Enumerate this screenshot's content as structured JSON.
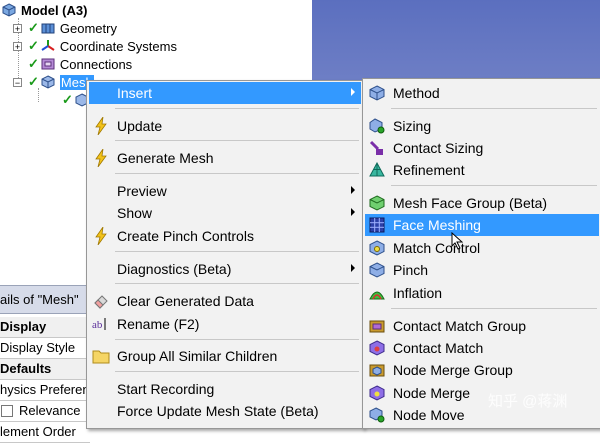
{
  "tree": {
    "root": "Model (A3)",
    "items": [
      "Geometry",
      "Coordinate Systems",
      "Connections",
      "Mesh"
    ]
  },
  "details": {
    "title": "ails of \"Mesh\"",
    "rows": [
      "Display",
      "Display Style",
      "Defaults",
      "hysics Preferen",
      "Relevance",
      "lement Order"
    ]
  },
  "main_menu": {
    "insert": "Insert",
    "update": "Update",
    "generate_mesh": "Generate Mesh",
    "preview": "Preview",
    "show": "Show",
    "create_pinch": "Create Pinch Controls",
    "diagnostics": "Diagnostics (Beta)",
    "clear_generated": "Clear Generated Data",
    "rename": "Rename (F2)",
    "group_similar": "Group All Similar Children",
    "start_recording": "Start Recording",
    "force_update": "Force Update Mesh State (Beta)"
  },
  "sub_menu": {
    "method": "Method",
    "sizing": "Sizing",
    "contact_sizing": "Contact Sizing",
    "refinement": "Refinement",
    "mesh_face_group": "Mesh Face Group (Beta)",
    "face_meshing": "Face Meshing",
    "match_control": "Match Control",
    "pinch": "Pinch",
    "inflation": "Inflation",
    "contact_match_group": "Contact Match Group",
    "contact_match": "Contact Match",
    "node_merge_group": "Node Merge Group",
    "node_merge": "Node Merge",
    "node_move": "Node Move"
  },
  "watermark": "知乎 @蒋渊",
  "colors": {
    "highlight": "#3399ff",
    "menu_bg": "#f2f2f2",
    "check": "#1a9a1a",
    "lightning": "#f3c31a"
  },
  "icons": [
    "cube-icon",
    "lightning-icon",
    "eraser-icon",
    "rename-icon",
    "folder-icon",
    "grid-icon",
    "pyramid-icon",
    "arrow-icon"
  ]
}
